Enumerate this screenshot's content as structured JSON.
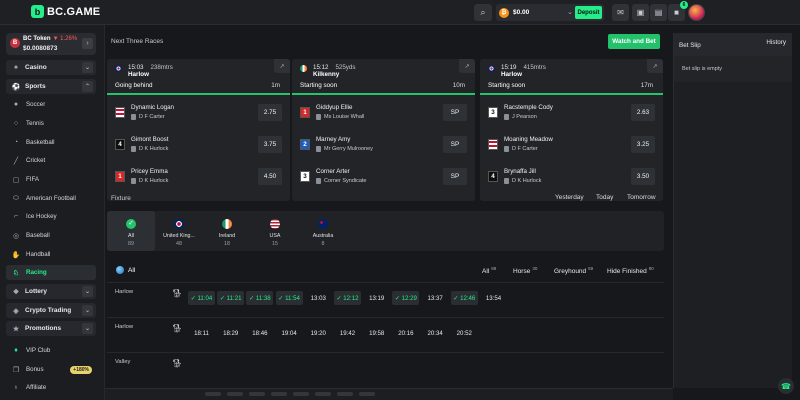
{
  "topbar": {
    "logo": "BC.GAME",
    "balance": "$0.00",
    "deposit": "Deposit",
    "notif_count": "6"
  },
  "sidebar": {
    "token": {
      "name": "BC Token",
      "change": "▼ 1.26%",
      "price": "$0.0080873"
    },
    "groups": [
      {
        "label": "Casino"
      },
      {
        "label": "Sports"
      }
    ],
    "sports": [
      "Soccer",
      "Tennis",
      "Basketball",
      "Cricket",
      "FIFA",
      "American Football",
      "Ice Hockey",
      "Baseball",
      "Handball",
      "Racing"
    ],
    "lower": [
      {
        "label": "Lottery"
      },
      {
        "label": "Crypto Trading"
      },
      {
        "label": "Promotions"
      }
    ],
    "vip": "VIP Club",
    "bonus": "Bonus",
    "bonus_badge": "+180%",
    "affiliate": "Affiliate"
  },
  "main": {
    "next_title": "Next Three Races",
    "watch_bet": "Watch and Bet",
    "races": [
      {
        "time": "15:03",
        "dist": "238mtrs",
        "venue": "Harlow",
        "status": "Going behind",
        "mins": "1m",
        "flag": "uk",
        "runners": [
          {
            "num": "",
            "name": "Dynamic Logan",
            "jockey": "D F Carter",
            "odds": "2.75",
            "numstyle": "trap"
          },
          {
            "num": "4",
            "name": "Gimont Boost",
            "jockey": "D K Hurlock",
            "odds": "3.75",
            "numstyle": "black"
          },
          {
            "num": "1",
            "name": "Pricey Emma",
            "jockey": "D K Hurlock",
            "odds": "4.50",
            "numstyle": "red"
          }
        ]
      },
      {
        "time": "15:12",
        "dist": "525yds",
        "venue": "Kilkenny",
        "status": "Starting soon",
        "mins": "10m",
        "flag": "ie",
        "runners": [
          {
            "num": "1",
            "name": "Giddyup Ellie",
            "jockey": "Ms Louise Whall",
            "odds": "SP",
            "numstyle": "red"
          },
          {
            "num": "2",
            "name": "Marney Amy",
            "jockey": "Mr Gerry Mulrooney",
            "odds": "SP",
            "numstyle": "blue"
          },
          {
            "num": "3",
            "name": "Corner Arter",
            "jockey": "Corner Syndicate",
            "odds": "SP",
            "numstyle": "white"
          }
        ]
      },
      {
        "time": "15:19",
        "dist": "415mtrs",
        "venue": "Harlow",
        "status": "Starting soon",
        "mins": "17m",
        "flag": "uk",
        "runners": [
          {
            "num": "3",
            "name": "Racstemple Cody",
            "jockey": "J Pearson",
            "odds": "2.63",
            "numstyle": "white"
          },
          {
            "num": "",
            "name": "Moaning Meadow",
            "jockey": "D F Carter",
            "odds": "3.25",
            "numstyle": "trap"
          },
          {
            "num": "4",
            "name": "Brynaffa Jill",
            "jockey": "D K Hurlock",
            "odds": "3.50",
            "numstyle": "black"
          }
        ]
      }
    ],
    "fixture_title": "Fixture",
    "days": [
      "Yesterday",
      "Today",
      "Tomorrow"
    ],
    "regions": [
      {
        "name": "All",
        "count": "89",
        "flag": "all"
      },
      {
        "name": "United King...",
        "count": "48",
        "flag": "uk"
      },
      {
        "name": "Ireland",
        "count": "18",
        "flag": "ie"
      },
      {
        "name": "USA",
        "count": "15",
        "flag": "us"
      },
      {
        "name": "Australia",
        "count": "8",
        "flag": "au"
      }
    ],
    "filter_all": "All",
    "types": [
      {
        "label": "All",
        "count": "89"
      },
      {
        "label": "Horse",
        "count": "30"
      },
      {
        "label": "Greyhound",
        "count": "59"
      },
      {
        "label": "Hide Finished",
        "count": "80"
      }
    ],
    "events": [
      {
        "venue": "Harlow",
        "type": "greyhound",
        "slots": [
          {
            "t": "✓ 11:04",
            "done": true
          },
          {
            "t": "✓ 11:21",
            "done": true
          },
          {
            "t": "✓ 11:38",
            "done": true
          },
          {
            "t": "✓ 11:54",
            "done": true
          },
          {
            "t": "13:03",
            "done": false
          },
          {
            "t": "✓ 12:12",
            "done": true
          },
          {
            "t": "13:19",
            "done": false
          },
          {
            "t": "✓ 12:29",
            "done": true
          },
          {
            "t": "13:37",
            "done": false
          },
          {
            "t": "✓ 12:46",
            "done": true
          },
          {
            "t": "13:54",
            "done": false
          }
        ]
      },
      {
        "venue": "Harlow",
        "type": "greyhound",
        "slots": [
          {
            "t": "18:11",
            "done": false
          },
          {
            "t": "18:29",
            "done": false
          },
          {
            "t": "18:46",
            "done": false
          },
          {
            "t": "19:04",
            "done": false
          },
          {
            "t": "19:20",
            "done": false
          },
          {
            "t": "19:42",
            "done": false
          },
          {
            "t": "19:58",
            "done": false
          },
          {
            "t": "20:16",
            "done": false
          },
          {
            "t": "20:34",
            "done": false
          },
          {
            "t": "20:52",
            "done": false
          }
        ]
      },
      {
        "venue": "Valley",
        "type": "greyhound",
        "slots": []
      }
    ]
  },
  "betslip": {
    "title": "Bet Slip",
    "history": "History",
    "empty": "Bet slip is empty"
  }
}
